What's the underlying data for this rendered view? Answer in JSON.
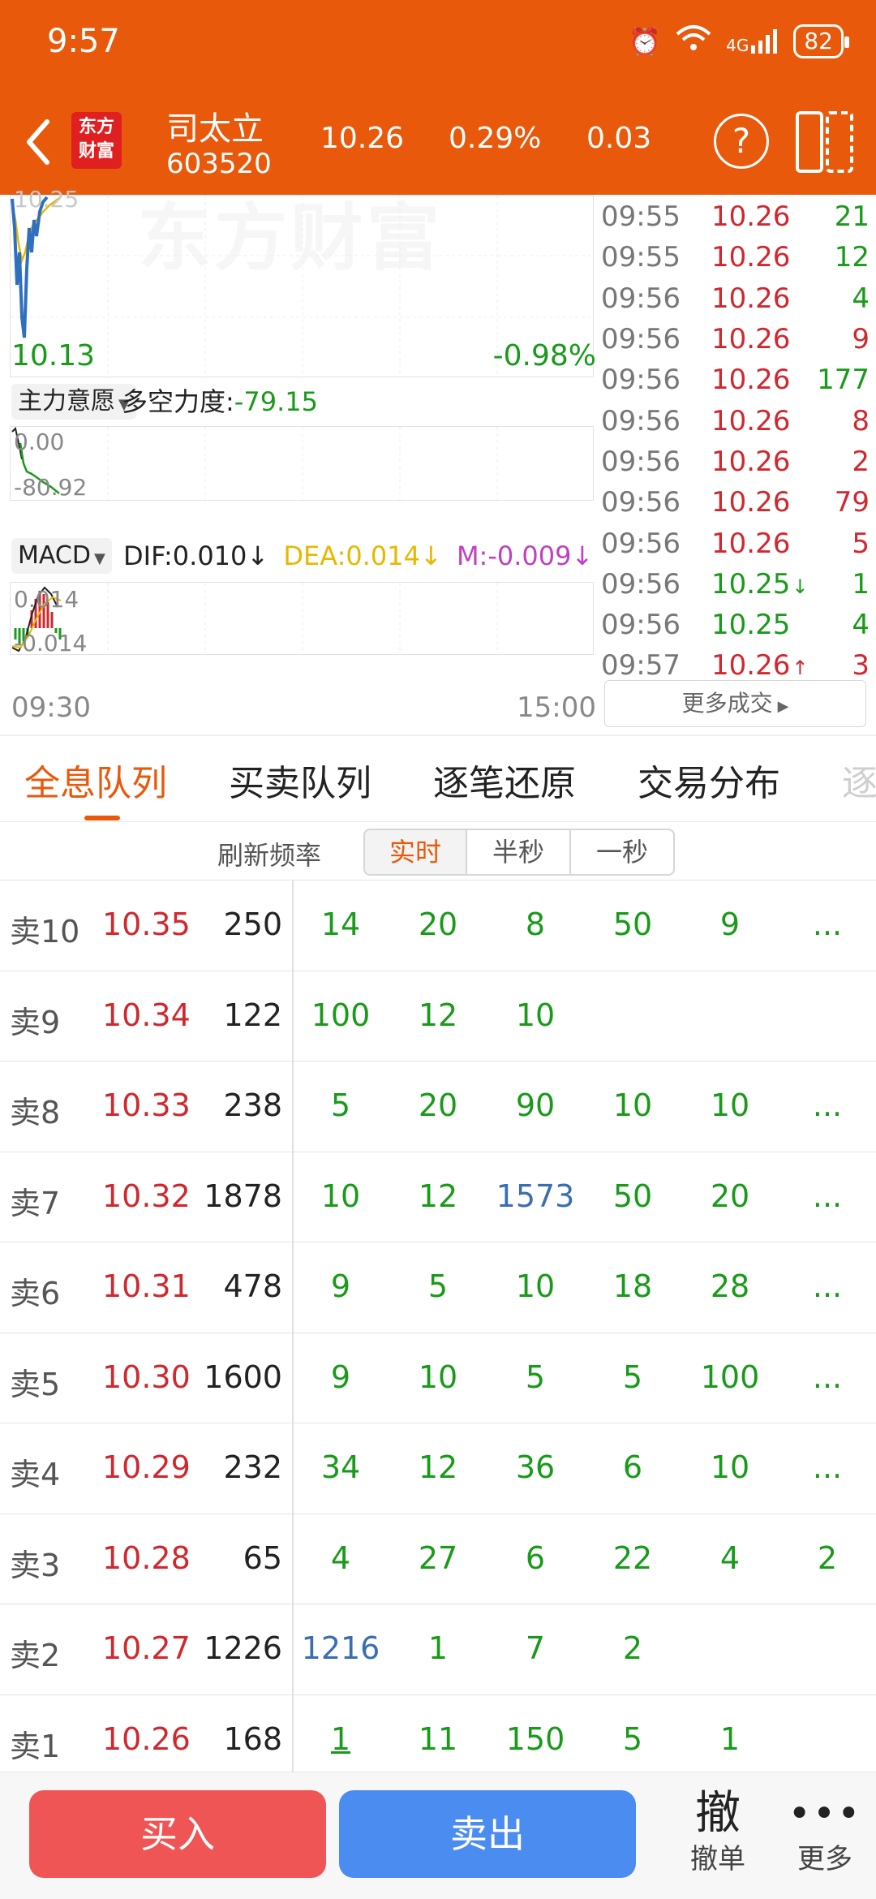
{
  "status_bar": {
    "time": "9:57",
    "network": "4G",
    "battery": "82"
  },
  "header": {
    "logo_line1": "东方",
    "logo_line2": "财富",
    "stock_name": "司太立",
    "stock_code": "603520",
    "price": "10.26",
    "change_pct": "0.29%",
    "change": "0.03"
  },
  "chart": {
    "top_label": "10.25",
    "low_price": "10.13",
    "low_pct": "-0.98%",
    "indicator1": {
      "selector": "主力意愿",
      "label": "多空力度:",
      "value": "-79.15",
      "max_label": "0.00",
      "min_label": "-80.92"
    },
    "indicator2": {
      "selector": "MACD",
      "dif": "DIF:0.010",
      "dea": "DEA:0.014",
      "m": "M:-0.009",
      "max_label": "0.014",
      "min_label": "-0.014"
    },
    "time_start": "09:30",
    "time_end": "15:00"
  },
  "ticks": [
    {
      "time": "09:55",
      "price": "10.26",
      "vol": "21",
      "dir": "down",
      "arrow": ""
    },
    {
      "time": "09:55",
      "price": "10.26",
      "vol": "12",
      "dir": "down",
      "arrow": ""
    },
    {
      "time": "09:56",
      "price": "10.26",
      "vol": "4",
      "dir": "down",
      "arrow": ""
    },
    {
      "time": "09:56",
      "price": "10.26",
      "vol": "9",
      "dir": "up",
      "arrow": ""
    },
    {
      "time": "09:56",
      "price": "10.26",
      "vol": "177",
      "dir": "down",
      "arrow": ""
    },
    {
      "time": "09:56",
      "price": "10.26",
      "vol": "8",
      "dir": "up",
      "arrow": ""
    },
    {
      "time": "09:56",
      "price": "10.26",
      "vol": "2",
      "dir": "up",
      "arrow": ""
    },
    {
      "time": "09:56",
      "price": "10.26",
      "vol": "79",
      "dir": "up",
      "arrow": ""
    },
    {
      "time": "09:56",
      "price": "10.26",
      "vol": "5",
      "dir": "up",
      "arrow": ""
    },
    {
      "time": "09:56",
      "price": "10.25",
      "vol": "1",
      "dir": "down",
      "arrow": "↓"
    },
    {
      "time": "09:56",
      "price": "10.25",
      "vol": "4",
      "dir": "down",
      "arrow": ""
    },
    {
      "time": "09:57",
      "price": "10.26",
      "vol": "3",
      "dir": "up",
      "arrow": "↑"
    }
  ],
  "more_deals_label": "更多成交",
  "tabs": [
    "全息队列",
    "买卖队列",
    "逐笔还原",
    "交易分布",
    "逐"
  ],
  "refresh": {
    "label": "刷新频率",
    "options": [
      "实时",
      "半秒",
      "一秒"
    ]
  },
  "queue": [
    {
      "level": "卖10",
      "price": "10.35",
      "volume": "250",
      "orders": [
        "14",
        "20",
        "8",
        "50",
        "9",
        "..."
      ]
    },
    {
      "level": "卖9",
      "price": "10.34",
      "volume": "122",
      "orders": [
        "100",
        "12",
        "10"
      ]
    },
    {
      "level": "卖8",
      "price": "10.33",
      "volume": "238",
      "orders": [
        "5",
        "20",
        "90",
        "10",
        "10",
        "..."
      ]
    },
    {
      "level": "卖7",
      "price": "10.32",
      "volume": "1878",
      "orders": [
        "10",
        "12",
        "1573",
        "50",
        "20",
        "..."
      ]
    },
    {
      "level": "卖6",
      "price": "10.31",
      "volume": "478",
      "orders": [
        "9",
        "5",
        "10",
        "18",
        "28",
        "..."
      ]
    },
    {
      "level": "卖5",
      "price": "10.30",
      "volume": "1600",
      "orders": [
        "9",
        "10",
        "5",
        "5",
        "100",
        "..."
      ]
    },
    {
      "level": "卖4",
      "price": "10.29",
      "volume": "232",
      "orders": [
        "34",
        "12",
        "36",
        "6",
        "10",
        "..."
      ]
    },
    {
      "level": "卖3",
      "price": "10.28",
      "volume": "65",
      "orders": [
        "4",
        "27",
        "6",
        "22",
        "4",
        "2"
      ]
    },
    {
      "level": "卖2",
      "price": "10.27",
      "volume": "1226",
      "orders": [
        "1216",
        "1",
        "7",
        "2"
      ]
    },
    {
      "level": "卖1",
      "price": "10.26",
      "volume": "168",
      "orders": [
        "1",
        "11",
        "150",
        "5",
        "1"
      ]
    }
  ],
  "big_orders": [
    "1573",
    "1216"
  ],
  "bottom": {
    "buy": "买入",
    "sell": "卖出",
    "cancel_big": "撤",
    "cancel_small": "撤单",
    "more_dots": "•••",
    "more_small": "更多"
  },
  "colors": {
    "brand": "#e8590c",
    "up": "#d0282f",
    "down": "#1a9a1a",
    "dea": "#e6b800",
    "m": "#c040c0",
    "buy": "#ef5555",
    "sell": "#4a8cf0"
  }
}
